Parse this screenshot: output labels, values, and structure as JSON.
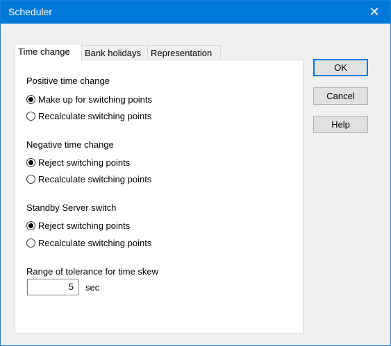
{
  "window": {
    "title": "Scheduler",
    "close_glyph": "✕"
  },
  "tabs": [
    "Time change",
    "Bank holidays",
    "Representation"
  ],
  "groups": {
    "positive": {
      "title": "Positive time change",
      "options": [
        "Make up for switching points",
        "Recalculate switching points"
      ],
      "selected": 0
    },
    "negative": {
      "title": "Negative time change",
      "options": [
        "Reject switching points",
        "Recalculate switching points"
      ],
      "selected": 0
    },
    "standby": {
      "title": "Standby Server switch",
      "options": [
        "Reject switching points",
        "Recalculate switching points"
      ],
      "selected": 0
    }
  },
  "tolerance": {
    "label": "Range of tolerance for time skew",
    "value": "5",
    "unit": "sec"
  },
  "buttons": {
    "ok": "OK",
    "cancel": "Cancel",
    "help": "Help"
  },
  "colors": {
    "titlebar": "#0078d7",
    "default_button_border": "#0078d7"
  }
}
